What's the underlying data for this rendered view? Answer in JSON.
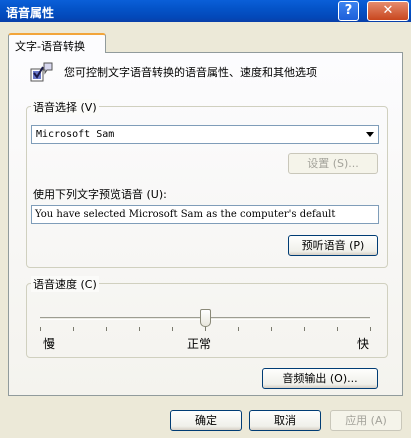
{
  "window": {
    "title": "语音属性",
    "help_button": "?",
    "close_button": "✕"
  },
  "tab": {
    "label": "文字-语音转换"
  },
  "intro": {
    "text": "您可控制文字语音转换的语音属性、速度和其他选项",
    "icon": "speech-properties-icon"
  },
  "voice_selection": {
    "group_label": "语音选择 (V)",
    "selected": "Microsoft Sam",
    "settings_button": "设置 (S)..."
  },
  "preview": {
    "label": "使用下列文字预览语音 (U):",
    "text": "You have selected Microsoft Sam as the computer's default",
    "preview_button": "预听语音 (P)"
  },
  "voice_rate": {
    "group_label": "语音速度 (C)",
    "slow": "慢",
    "normal": "正常",
    "fast": "快",
    "level_fraction": 0.5
  },
  "buttons": {
    "audio_output": "音频输出 (O)...",
    "ok": "确定",
    "cancel": "取消",
    "apply": "应用 (A)"
  },
  "colors": {
    "titlebar": "#0453c8",
    "dialog_bg": "#ece9d8",
    "tab_highlight": "#f2a53b"
  }
}
